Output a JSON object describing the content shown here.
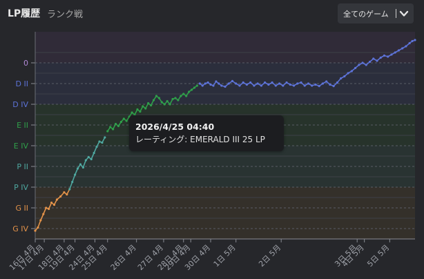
{
  "header": {
    "title": "LP履歴",
    "subtitle": "ランク戦",
    "filter_label": "全てのゲーム"
  },
  "tooltip": {
    "date": "2026/4/25 04:40",
    "rating": "レーティング: EMERALD III 25 LP"
  },
  "colors": {
    "gold": "#e4934a",
    "platinum": "#4fa8a0",
    "emerald": "#2fa04a",
    "diamond": "#5d73d8",
    "master": "#b38ad8"
  },
  "chart_data": {
    "type": "line",
    "y_axis": {
      "ticks": [
        {
          "label": "G IV",
          "tier": "gold"
        },
        {
          "label": "G II",
          "tier": "gold"
        },
        {
          "label": "P IV",
          "tier": "platinum"
        },
        {
          "label": "P II",
          "tier": "platinum"
        },
        {
          "label": "E IV",
          "tier": "emerald"
        },
        {
          "label": "E II",
          "tier": "emerald"
        },
        {
          "label": "D IV",
          "tier": "diamond"
        },
        {
          "label": "D II",
          "tier": "diamond"
        },
        {
          "label": "0",
          "tier": "master"
        }
      ]
    },
    "x_axis": {
      "ticks": [
        {
          "label": "16日 4月",
          "day": 16.0
        },
        {
          "label": "17日 4月",
          "day": 16.5
        },
        {
          "label": "18日 4月",
          "day": 17.6
        },
        {
          "label": "19日 4月",
          "day": 18.2
        },
        {
          "label": "24日 4月",
          "day": 19.3
        },
        {
          "label": "25日 4月",
          "day": 20.0
        },
        {
          "label": "26日 4月",
          "day": 21.6
        },
        {
          "label": "27日 4月",
          "day": 23.1
        },
        {
          "label": "28日 4月",
          "day": 24.2
        },
        {
          "label": "29日 4月",
          "day": 24.6
        },
        {
          "label": "30日 4月",
          "day": 25.7
        },
        {
          "label": "1日 5月",
          "day": 27.1
        },
        {
          "label": "2日 5月",
          "day": 29.6
        },
        {
          "label": "3日 5月",
          "day": 33.8
        },
        {
          "label": "4日 5月",
          "day": 34.2
        },
        {
          "label": "5日 5月",
          "day": 35.6
        }
      ],
      "range": [
        16.0,
        37.0
      ]
    },
    "series": [
      {
        "tier_segments": [
          {
            "tier": "gold",
            "from_day": 16.0,
            "to_day": 17.9
          },
          {
            "tier": "platinum",
            "from_day": 17.9,
            "to_day": 19.9
          },
          {
            "tier": "emerald",
            "from_day": 19.9,
            "to_day": 25.0
          },
          {
            "tier": "diamond",
            "from_day": 25.0,
            "to_day": 37.0
          }
        ],
        "points": [
          {
            "day": 16.0,
            "lp": -10
          },
          {
            "day": 16.15,
            "lp": 5
          },
          {
            "day": 16.3,
            "lp": 40
          },
          {
            "day": 16.45,
            "lp": 70
          },
          {
            "day": 16.6,
            "lp": 100
          },
          {
            "day": 16.75,
            "lp": 95
          },
          {
            "day": 16.9,
            "lp": 125
          },
          {
            "day": 17.05,
            "lp": 115
          },
          {
            "day": 17.2,
            "lp": 140
          },
          {
            "day": 17.4,
            "lp": 155
          },
          {
            "day": 17.6,
            "lp": 175
          },
          {
            "day": 17.75,
            "lp": 165
          },
          {
            "day": 17.9,
            "lp": 190
          },
          {
            "day": 18.05,
            "lp": 225
          },
          {
            "day": 18.2,
            "lp": 260
          },
          {
            "day": 18.35,
            "lp": 290
          },
          {
            "day": 18.5,
            "lp": 310
          },
          {
            "day": 18.65,
            "lp": 295
          },
          {
            "day": 18.8,
            "lp": 330
          },
          {
            "day": 18.95,
            "lp": 345
          },
          {
            "day": 19.1,
            "lp": 335
          },
          {
            "day": 19.25,
            "lp": 365
          },
          {
            "day": 19.4,
            "lp": 395
          },
          {
            "day": 19.55,
            "lp": 420
          },
          {
            "day": 19.7,
            "lp": 415
          },
          {
            "day": 19.85,
            "lp": 440
          },
          {
            "day": 20.0,
            "lp": 470
          },
          {
            "day": 20.15,
            "lp": 490
          },
          {
            "day": 20.3,
            "lp": 480
          },
          {
            "day": 20.45,
            "lp": 505
          },
          {
            "day": 20.6,
            "lp": 495
          },
          {
            "day": 20.75,
            "lp": 515
          },
          {
            "day": 20.9,
            "lp": 530
          },
          {
            "day": 21.05,
            "lp": 520
          },
          {
            "day": 21.2,
            "lp": 540
          },
          {
            "day": 21.35,
            "lp": 560
          },
          {
            "day": 21.5,
            "lp": 550
          },
          {
            "day": 21.65,
            "lp": 575
          },
          {
            "day": 21.8,
            "lp": 565
          },
          {
            "day": 21.95,
            "lp": 590
          },
          {
            "day": 22.1,
            "lp": 580
          },
          {
            "day": 22.25,
            "lp": 605
          },
          {
            "day": 22.4,
            "lp": 595
          },
          {
            "day": 22.55,
            "lp": 620
          },
          {
            "day": 22.7,
            "lp": 640
          },
          {
            "day": 22.85,
            "lp": 630
          },
          {
            "day": 23.0,
            "lp": 610
          },
          {
            "day": 23.15,
            "lp": 600
          },
          {
            "day": 23.3,
            "lp": 615
          },
          {
            "day": 23.45,
            "lp": 600
          },
          {
            "day": 23.6,
            "lp": 625
          },
          {
            "day": 23.75,
            "lp": 630
          },
          {
            "day": 23.9,
            "lp": 620
          },
          {
            "day": 24.05,
            "lp": 640
          },
          {
            "day": 24.2,
            "lp": 650
          },
          {
            "day": 24.35,
            "lp": 640
          },
          {
            "day": 24.5,
            "lp": 660
          },
          {
            "day": 24.65,
            "lp": 670
          },
          {
            "day": 24.8,
            "lp": 680
          },
          {
            "day": 24.95,
            "lp": 690
          },
          {
            "day": 25.1,
            "lp": 700
          },
          {
            "day": 25.25,
            "lp": 690
          },
          {
            "day": 25.4,
            "lp": 700
          },
          {
            "day": 25.55,
            "lp": 705
          },
          {
            "day": 25.7,
            "lp": 695
          },
          {
            "day": 25.85,
            "lp": 690
          },
          {
            "day": 26.0,
            "lp": 710
          },
          {
            "day": 26.15,
            "lp": 700
          },
          {
            "day": 26.3,
            "lp": 690
          },
          {
            "day": 26.5,
            "lp": 685
          },
          {
            "day": 26.7,
            "lp": 700
          },
          {
            "day": 26.9,
            "lp": 712
          },
          {
            "day": 27.1,
            "lp": 700
          },
          {
            "day": 27.3,
            "lp": 690
          },
          {
            "day": 27.5,
            "lp": 705
          },
          {
            "day": 27.7,
            "lp": 695
          },
          {
            "day": 27.9,
            "lp": 705
          },
          {
            "day": 28.1,
            "lp": 690
          },
          {
            "day": 28.3,
            "lp": 700
          },
          {
            "day": 28.5,
            "lp": 690
          },
          {
            "day": 28.7,
            "lp": 705
          },
          {
            "day": 28.9,
            "lp": 695
          },
          {
            "day": 29.1,
            "lp": 705
          },
          {
            "day": 29.3,
            "lp": 690
          },
          {
            "day": 29.5,
            "lp": 700
          },
          {
            "day": 29.7,
            "lp": 690
          },
          {
            "day": 29.9,
            "lp": 705
          },
          {
            "day": 30.1,
            "lp": 695
          },
          {
            "day": 30.3,
            "lp": 690
          },
          {
            "day": 30.5,
            "lp": 700
          },
          {
            "day": 30.7,
            "lp": 705
          },
          {
            "day": 30.9,
            "lp": 690
          },
          {
            "day": 31.1,
            "lp": 700
          },
          {
            "day": 31.3,
            "lp": 690
          },
          {
            "day": 31.5,
            "lp": 695
          },
          {
            "day": 31.7,
            "lp": 688
          },
          {
            "day": 31.9,
            "lp": 700
          },
          {
            "day": 32.1,
            "lp": 710
          },
          {
            "day": 32.3,
            "lp": 695
          },
          {
            "day": 32.5,
            "lp": 688
          },
          {
            "day": 32.7,
            "lp": 705
          },
          {
            "day": 32.9,
            "lp": 725
          },
          {
            "day": 33.1,
            "lp": 735
          },
          {
            "day": 33.3,
            "lp": 750
          },
          {
            "day": 33.5,
            "lp": 760
          },
          {
            "day": 33.7,
            "lp": 775
          },
          {
            "day": 33.9,
            "lp": 790
          },
          {
            "day": 34.1,
            "lp": 800
          },
          {
            "day": 34.3,
            "lp": 790
          },
          {
            "day": 34.5,
            "lp": 805
          },
          {
            "day": 34.7,
            "lp": 820
          },
          {
            "day": 34.9,
            "lp": 810
          },
          {
            "day": 35.1,
            "lp": 825
          },
          {
            "day": 35.3,
            "lp": 835
          },
          {
            "day": 35.5,
            "lp": 830
          },
          {
            "day": 35.7,
            "lp": 840
          },
          {
            "day": 35.9,
            "lp": 850
          },
          {
            "day": 36.1,
            "lp": 860
          },
          {
            "day": 36.3,
            "lp": 870
          },
          {
            "day": 36.5,
            "lp": 880
          },
          {
            "day": 36.7,
            "lp": 895
          },
          {
            "day": 36.85,
            "lp": 905
          },
          {
            "day": 37.0,
            "lp": 910
          }
        ]
      }
    ],
    "ylim": [
      -50,
      950
    ],
    "grid": true
  }
}
